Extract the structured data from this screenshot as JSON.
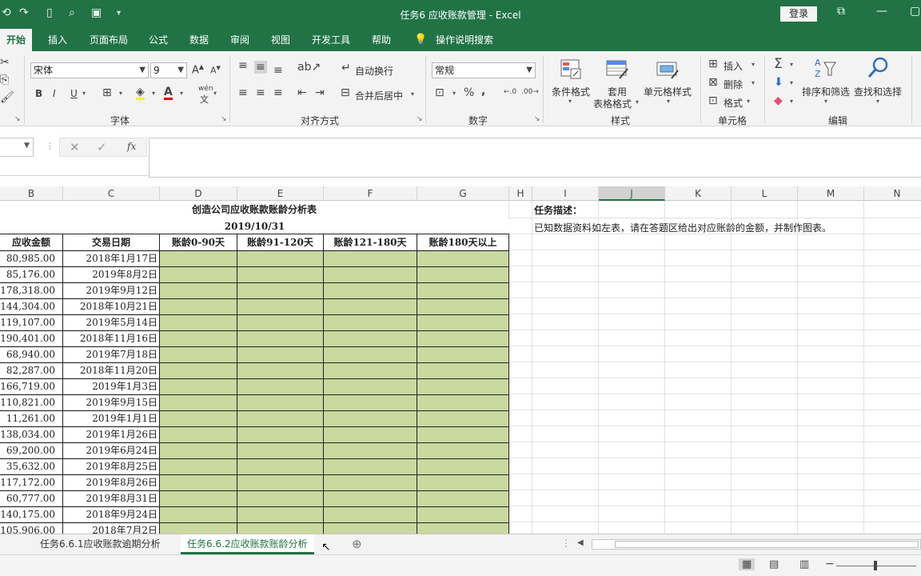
{
  "window": {
    "title": "任务6 应收账款管理 - Excel",
    "login": "登录"
  },
  "tabs": [
    "开始",
    "插入",
    "页面布局",
    "公式",
    "数据",
    "审阅",
    "视图",
    "开发工具",
    "帮助",
    "操作说明搜索"
  ],
  "ribbon": {
    "font": {
      "name": "宋体",
      "size": "9",
      "label": "字体",
      "phonetic": "wén"
    },
    "alignment": {
      "wrap": "自动换行",
      "merge": "合并后居中",
      "label": "对齐方式"
    },
    "number": {
      "format": "常规",
      "label": "数字",
      "percent": "%",
      "comma": ","
    },
    "styles": {
      "conditional": "条件格式",
      "table_fmt_1": "套用",
      "table_fmt_2": "表格格式",
      "cell_styles": "单元格样式",
      "label": "样式"
    },
    "cells": {
      "insert": "插入",
      "delete": "删除",
      "format": "格式",
      "label": "单元格"
    },
    "editing": {
      "sort": "排序和筛选",
      "find": "查找和选择",
      "label": "编辑"
    }
  },
  "formula_bar": {
    "fx": "fx",
    "value": ""
  },
  "columns": [
    "B",
    "C",
    "D",
    "E",
    "F",
    "G",
    "H",
    "I",
    "J",
    "K",
    "L",
    "M",
    "N"
  ],
  "sheet": {
    "title": "创造公司应收账款账龄分析表",
    "date": "2019/10/31",
    "headers": [
      "应收金额",
      "交易日期",
      "账龄0-90天",
      "账龄91-120天",
      "账龄121-180天",
      "账龄180天以上"
    ],
    "rows": [
      [
        "80,985.00",
        "2018年1月17日"
      ],
      [
        "85,176.00",
        "2019年8月2日"
      ],
      [
        "178,318.00",
        "2019年9月12日"
      ],
      [
        "144,304.00",
        "2018年10月21日"
      ],
      [
        "119,107.00",
        "2019年5月14日"
      ],
      [
        "190,401.00",
        "2018年11月16日"
      ],
      [
        "68,940.00",
        "2019年7月18日"
      ],
      [
        "82,287.00",
        "2018年11月20日"
      ],
      [
        "166,719.00",
        "2019年1月3日"
      ],
      [
        "110,821.00",
        "2019年9月15日"
      ],
      [
        "11,261.00",
        "2019年1月1日"
      ],
      [
        "138,034.00",
        "2019年1月26日"
      ],
      [
        "69,200.00",
        "2019年6月24日"
      ],
      [
        "35,632.00",
        "2019年8月25日"
      ],
      [
        "117,172.00",
        "2019年8月26日"
      ],
      [
        "60,777.00",
        "2019年8月31日"
      ],
      [
        "140,175.00",
        "2018年9月24日"
      ],
      [
        "105,906.00",
        "2018年7月2日"
      ]
    ],
    "task_label": "任务描述：",
    "task_text": "已知数据资料如左表，请在答题区给出对应账龄的金额，并制作图表。"
  },
  "sheet_tabs": [
    "任务6.6.1应收账款逾期分析",
    "任务6.6.2应收账款账龄分析"
  ],
  "colors": {
    "accent": "#217346",
    "fill": "#c9d9a0"
  }
}
